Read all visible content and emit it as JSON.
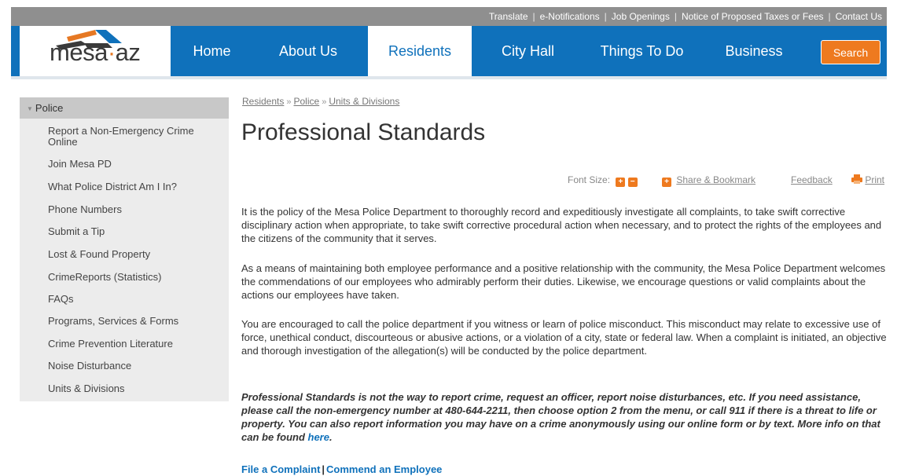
{
  "top_links": [
    "Translate",
    "e-Notifications",
    "Job Openings",
    "Notice of Proposed Taxes or Fees",
    "Contact Us"
  ],
  "logo": {
    "text_a": "mesa",
    "dot": "·",
    "text_b": "az",
    "colors": [
      "#e67823",
      "#0f71bb",
      "#3a3a3a"
    ]
  },
  "nav": {
    "items": [
      "Home",
      "About Us",
      "Residents",
      "City Hall",
      "Things To Do",
      "Business"
    ],
    "active": "Residents",
    "search_label": "Search"
  },
  "sidebar": {
    "heading": "Police",
    "items": [
      "Report a Non-Emergency Crime Online",
      "Join Mesa PD",
      "What Police District Am I In?",
      "Phone Numbers",
      "Submit a Tip",
      "Lost & Found Property",
      "CrimeReports (Statistics)",
      "FAQs",
      "Programs, Services & Forms",
      "Crime Prevention Literature",
      "Noise Disturbance",
      "Units & Divisions"
    ]
  },
  "breadcrumb": [
    "Residents",
    "Police",
    "Units & Divisions"
  ],
  "breadcrumb_sep": "»",
  "page": {
    "title": "Professional Standards",
    "tools": {
      "font_size_label": "Font Size:",
      "plus": "+",
      "minus": "−",
      "share_label": "Share & Bookmark",
      "feedback_label": "Feedback",
      "print_label": "Print"
    },
    "paragraphs": [
      "It is the policy of the Mesa Police Department to thoroughly record and expeditiously investigate all complaints, to take swift corrective disciplinary action when appropriate, to take swift corrective procedural action when necessary, and to protect the rights of the employees and the citizens of the community that it serves.",
      "As a means of maintaining both employee performance and a positive relationship with the community, the Mesa Police Department welcomes the commendations of our employees who admirably perform their duties. Likewise, we encourage questions or valid complaints about the actions our employees have taken.",
      "You are encouraged to call the police department if you witness or learn of police misconduct. This misconduct may relate to excessive use of force, unethical conduct, discourteous or abusive actions, or a violation of a city, state or federal law. When a complaint is initiated, an objective and thorough investigation of the allegation(s) will be conducted by the police department."
    ],
    "notice": "Professional Standards is not the way to report crime, request an officer, report noise disturbances, etc. If you need assistance, please call the non-emergency number at 480-644-2211, then choose option 2 from the menu, or call 911 if there is a threat to life or property. You can also report information you may have on a crime anonymously using our online form or by text. More info on that can be found",
    "notice_link": "here",
    "notice_end": ".",
    "actions": {
      "file": "File a Complaint",
      "sep": "|",
      "commend": "Commend an Employee"
    }
  }
}
